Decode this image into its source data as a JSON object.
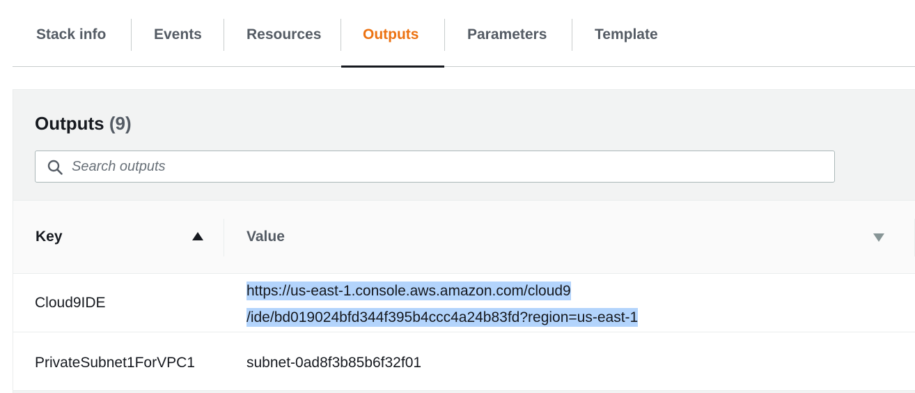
{
  "tabs": [
    {
      "label": "Stack info",
      "active": false
    },
    {
      "label": "Events",
      "active": false
    },
    {
      "label": "Resources",
      "active": false
    },
    {
      "label": "Outputs",
      "active": true
    },
    {
      "label": "Parameters",
      "active": false
    },
    {
      "label": "Template",
      "active": false
    }
  ],
  "outputs": {
    "title": "Outputs",
    "count": "(9)",
    "search": {
      "placeholder": "Search outputs",
      "value": "",
      "icon": "search-icon"
    },
    "columns": {
      "key": "Key",
      "key_sort": "ascending",
      "value": "Value",
      "value_sort": "descending"
    },
    "rows": [
      {
        "key": "Cloud9IDE",
        "value_lines": [
          "https://us-east-1.console.aws.amazon.com/cloud9",
          "/ide/bd019024bfd344f395b4ccc4a24b83fd?region=us-east-1"
        ],
        "selected": true
      },
      {
        "key": "PrivateSubnet1ForVPC1",
        "value": "subnet-0ad8f3b85b6f32f01",
        "selected": false
      }
    ]
  },
  "colors": {
    "active_tab": "#ec7211",
    "selection": "#b3d4fc",
    "panel_bg": "#f2f3f3"
  }
}
